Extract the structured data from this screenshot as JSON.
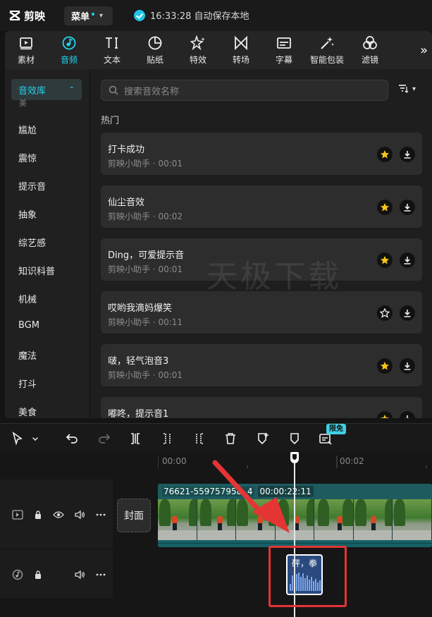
{
  "titlebar": {
    "app_name": "剪映",
    "menu_label": "菜单",
    "autosave_text": "16:33:28 自动保存本地"
  },
  "toolbar": {
    "tools": [
      {
        "label": "素材",
        "icon": "media-icon"
      },
      {
        "label": "音频",
        "icon": "audio-icon",
        "active": true
      },
      {
        "label": "文本",
        "icon": "text-icon"
      },
      {
        "label": "贴纸",
        "icon": "sticker-icon"
      },
      {
        "label": "特效",
        "icon": "effects-icon"
      },
      {
        "label": "转场",
        "icon": "transition-icon"
      },
      {
        "label": "字幕",
        "icon": "subtitle-icon"
      },
      {
        "label": "智能包装",
        "icon": "smart-pack-icon"
      },
      {
        "label": "滤镜",
        "icon": "filter-icon"
      }
    ],
    "more_label": "»"
  },
  "categories": {
    "header": "音效库",
    "cut_item": "美",
    "items": [
      "尴尬",
      "震惊",
      "提示音",
      "抽象",
      "综艺感",
      "知识科普",
      "机械",
      "BGM",
      "魔法",
      "打斗",
      "美食"
    ]
  },
  "search": {
    "placeholder": "搜索音效名称"
  },
  "section_title": "热门",
  "sounds": [
    {
      "name": "打卡成功",
      "meta": "剪映小助手 · 00:01",
      "favorited": true
    },
    {
      "name": "仙尘音效",
      "meta": "剪映小助手 · 00:02",
      "favorited": true
    },
    {
      "name": "Ding，可爱提示音",
      "meta": "剪映小助手 · 00:01",
      "favorited": true
    },
    {
      "name": "哎哟我滴妈爆笑",
      "meta": "剪映小助手 · 00:11",
      "favorited": false
    },
    {
      "name": "啵，轻气泡音3",
      "meta": "剪映小助手 · 00:01",
      "favorited": true
    },
    {
      "name": "嘟咚，提示音1",
      "meta": "",
      "favorited": true
    }
  ],
  "watermark": "天极下载",
  "timeline_toolbar": {
    "free_badge": "限免"
  },
  "timeline": {
    "ruler_labels": [
      "00:00",
      "00:02"
    ],
    "cover_label": "封面",
    "video_clip": {
      "name": "76621-559757958",
      "name_suffix": "4",
      "duration": "00:00:22:11"
    },
    "audio_clip": {
      "label": "砰，拳"
    }
  },
  "colors": {
    "accent": "#22d3ee",
    "star": "#f5c518",
    "highlight": "#e53434"
  }
}
